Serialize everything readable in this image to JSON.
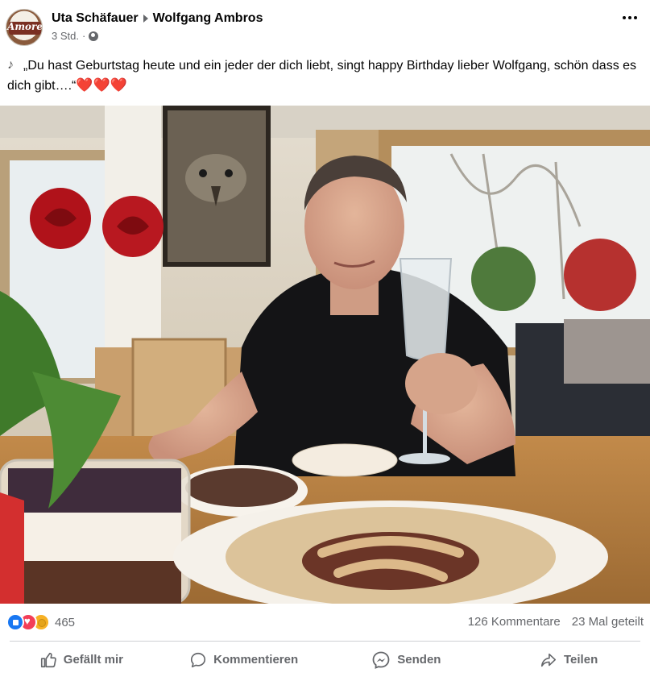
{
  "post": {
    "author": "Uta Schäfauer",
    "target": "Wolfgang Ambros",
    "avatar_logo": "Amore",
    "time": "3 Std.",
    "separator": "·",
    "privacy_icon": "globe-icon",
    "more_icon": "ellipsis-icon",
    "caption_icon": "music-note-icon",
    "caption_text": "„Du hast Geburtstag heute und ein jeder der dich liebt, singt happy Birthday lieber Wolfgang, schön dass es dich gibt….“",
    "caption_hearts": "❤️❤️❤️"
  },
  "stats": {
    "reaction_icons": [
      "like-icon",
      "love-icon",
      "care-icon"
    ],
    "reaction_count": "465",
    "comments": "126 Kommentare",
    "shares": "23 Mal geteilt"
  },
  "actions": {
    "like": "Gefällt mir",
    "comment": "Kommentieren",
    "send": "Senden",
    "share": "Teilen"
  },
  "colors": {
    "text_primary": "#050505",
    "text_secondary": "#65676b",
    "like_blue": "#1877f2",
    "love_red": "#f33e58",
    "care_yellow": "#f7b125",
    "divider": "#ced0d4"
  }
}
